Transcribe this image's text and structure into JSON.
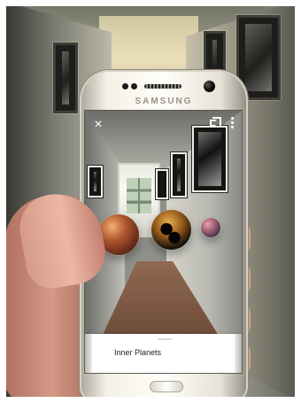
{
  "phone": {
    "brand": "SAMSUNG"
  },
  "ar_view": {
    "close_symbol": "×",
    "icons": {
      "close": "close-icon",
      "share": "share-icon",
      "more": "more-options-icon"
    },
    "planets": [
      {
        "semantic": "mercury-planet"
      },
      {
        "semantic": "venus-planet"
      },
      {
        "semantic": "earth-planet"
      }
    ],
    "bottom_sheet": {
      "title": "Inner Planets"
    }
  },
  "colors": {
    "screen_text": "#202124",
    "ui_icon": "#ffffff",
    "phone_white": "#fffef8"
  }
}
